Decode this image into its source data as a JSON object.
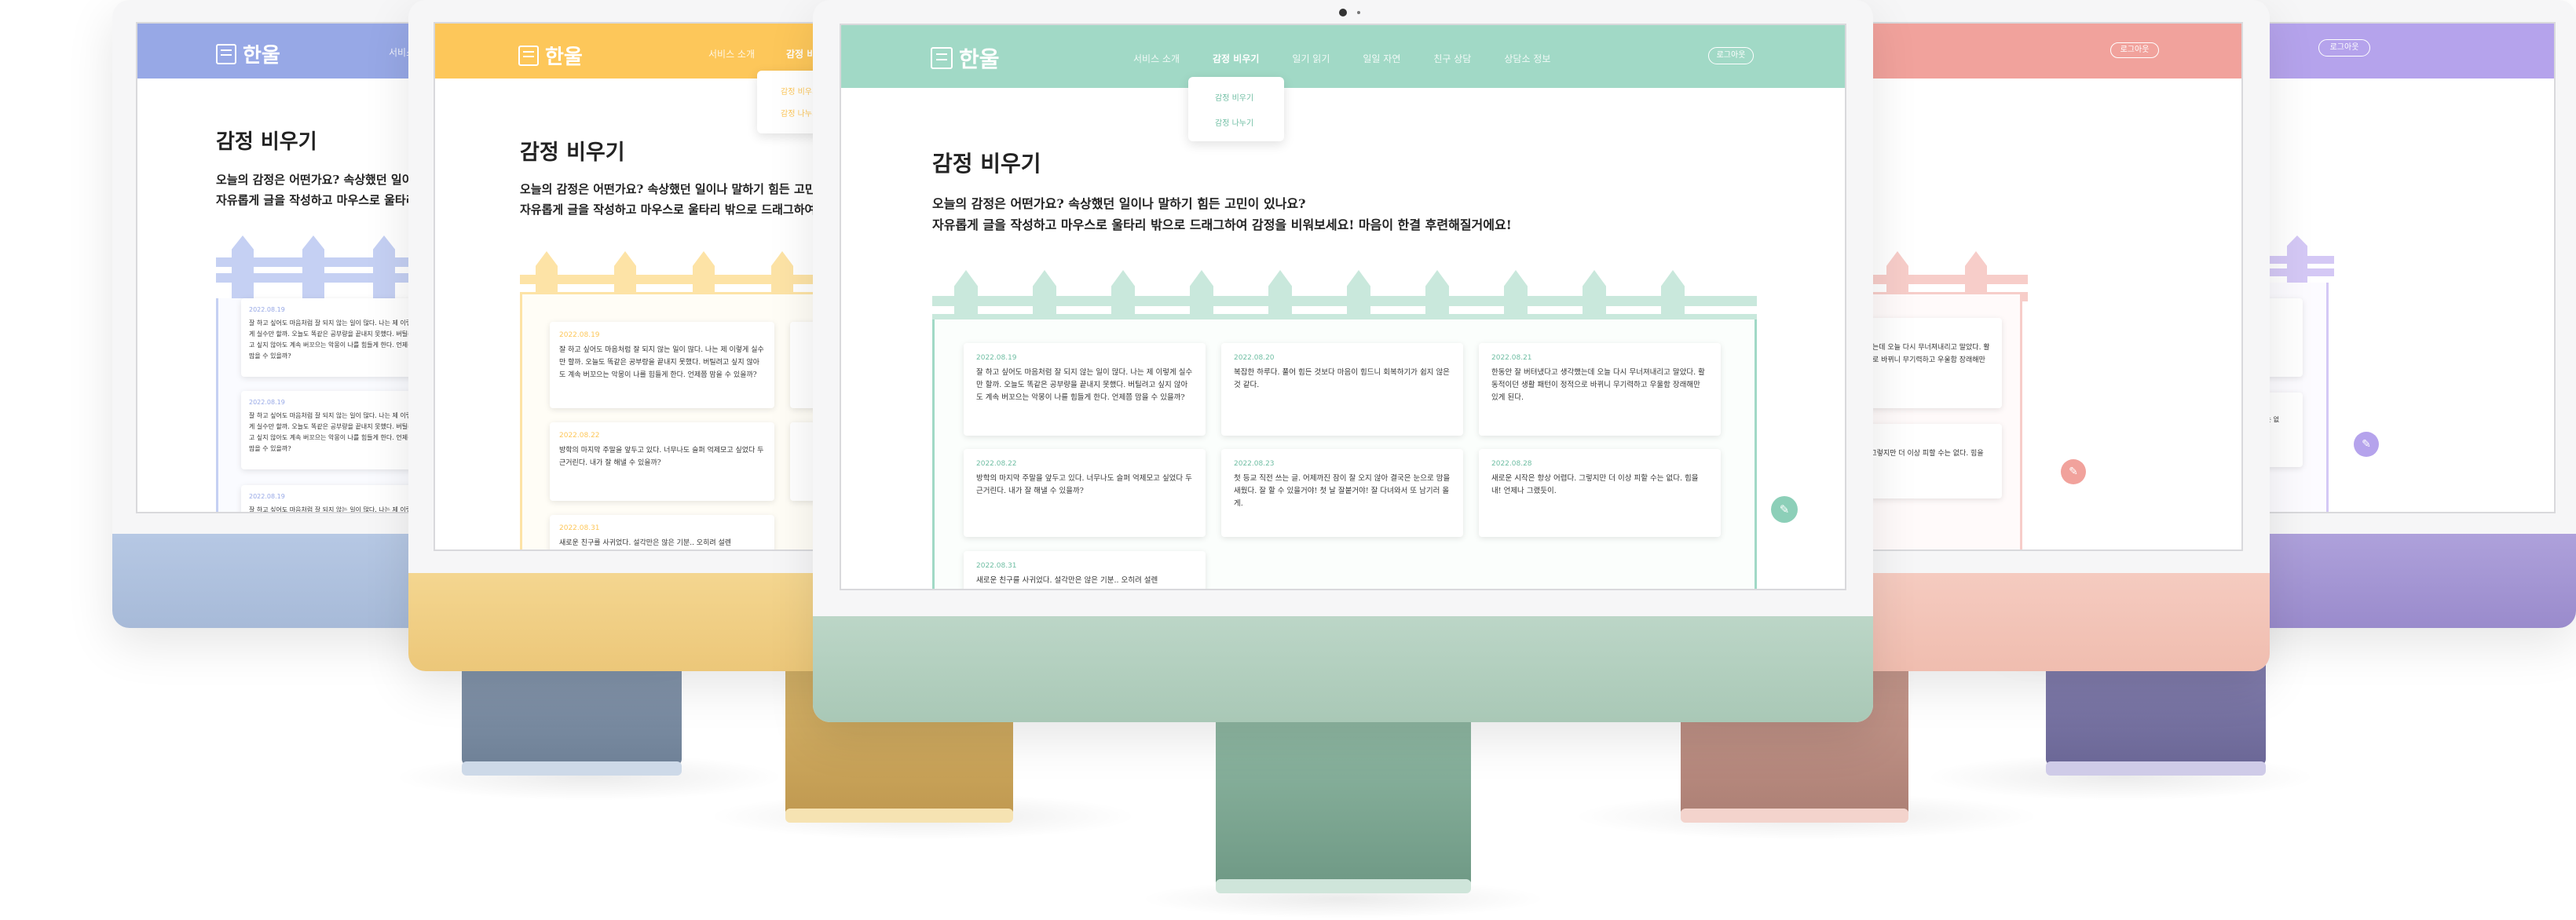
{
  "site": {
    "logo_text": "한울",
    "menu": [
      "서비스 소개",
      "감정 비우기",
      "일기 읽기",
      "일일 자연",
      "친구 상담",
      "상담소 정보"
    ],
    "login_label": "로그아웃",
    "dropdown": [
      "감정 비우기",
      "감정 나누기"
    ],
    "page_title": "감정 비우기",
    "intro_line1": "오늘의 감정은 어떤가요? 속상했던 일이나 말하기 힘든 고민이 있나요?",
    "intro_line2": "자유롭게 글을 작성하고 마우스로 울타리 밖으로 드래그하여 감정을 비워보세요! 마음이 한결 후련해질거에요!",
    "fab_icon": "pencil-icon"
  },
  "cards": [
    {
      "date": "2022.08.19",
      "text": "잘 하고 싶어도 마음처럼 잘 되지 않는 일이 많다. 나는 제 이렇게 실수만 할까. 오늘도 똑같은 공부량을 끝내지 못했다. 버틸려고 싶지 않아도 계속 버꼬으는 악몽이 나를 힘들게 한다. 언제쯤 맘을 수 있을까?"
    },
    {
      "date": "2022.08.20",
      "text": "복잡한 하루다. 풀어 힘든 것보다 마음이 힘드니 회복하기가 쉽지 않은 것 같다."
    },
    {
      "date": "2022.08.21",
      "text": "한동안 잘 버텨냈다고 생각했는데 오늘 다시 무너져내리고 말았다. 활동적이던 생활 패턴이 정적으로 바뀌니 무기력하고 우울함 장래해만 있게 된다."
    },
    {
      "date": "2022.08.22",
      "text": "방학의 마지막 주말을 앞두고 있다. 너무나도 슬퍼 억제모고 싶었다 두근거린다. 내가 잘 해낼 수 있을까?"
    },
    {
      "date": "2022.08.23",
      "text": "첫 등교 직전 쓰는 글. 어제까진 잠이 잘 오지 않아 결국은 눈으로 맘을 새웠다. 잘 할 수 있을거야! 첫 날 잘붙거야! 잘 다녀와서 또 남기러 올게."
    },
    {
      "date": "2022.08.28",
      "text": "새로운 시작은 항상 어렵다. 그렇지만 더 이상 피할 수는 없다. 힘을 내! 언제나 그랬듯이."
    },
    {
      "date": "2022.08.31",
      "text": "새로운 친구를 사귀었다. 설각만은 않은 기분.. 오히려 설렌"
    }
  ],
  "colors": {
    "blue": "#97a8e6",
    "yellow": "#fdc75a",
    "green": "#a1d9c6",
    "pink": "#f1a29c",
    "purple": "#b5a3ec"
  }
}
